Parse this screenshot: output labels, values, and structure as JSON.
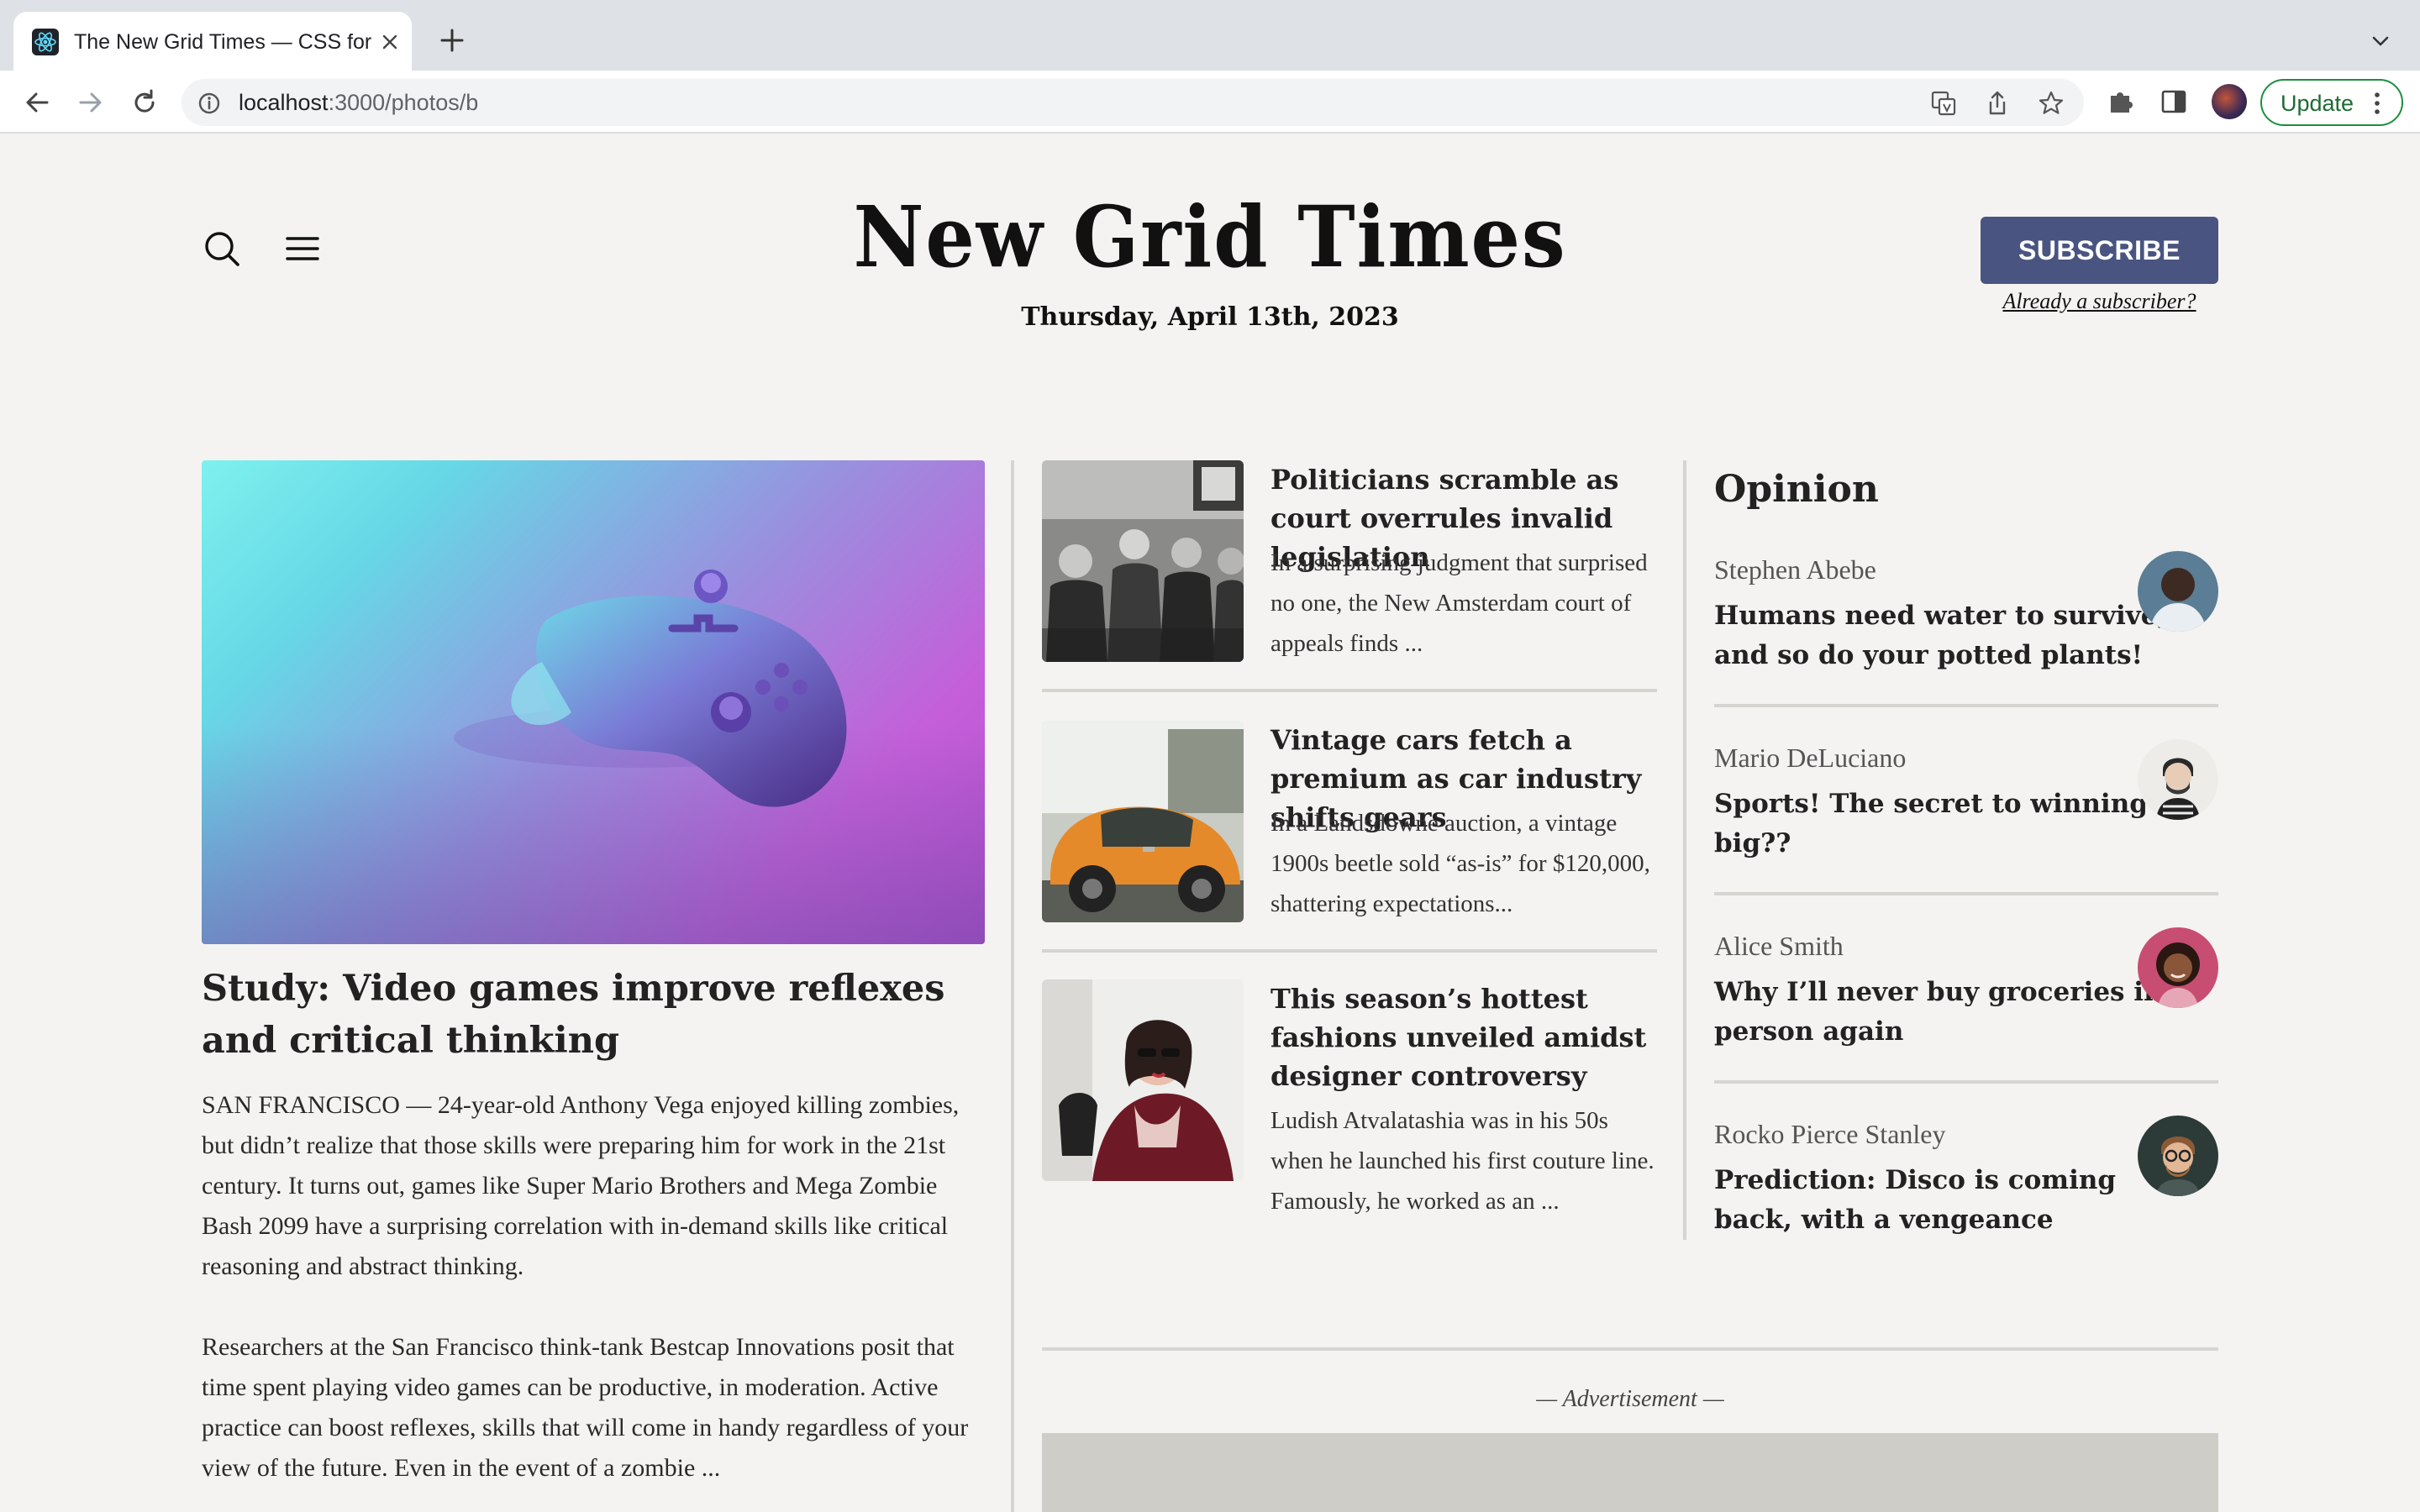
{
  "browser": {
    "tab_title": "The New Grid Times — CSS for",
    "url_host": "localhost",
    "url_rest": ":3000/photos/b",
    "update_label": "Update"
  },
  "header": {
    "masthead": "New Grid Times",
    "date": "Thursday, April 13th, 2023",
    "subscribe_label": "SUBSCRIBE",
    "already_label": "Already a subscriber?"
  },
  "main_story": {
    "headline": "Study: Video games improve reflexes and critical thinking",
    "paragraphs": [
      "SAN FRANCISCO — 24-year-old Anthony Vega enjoyed killing zombies, but didn’t realize that those skills were preparing him for work in the 21st century. It turns out, games like Super Mario Brothers and Mega Zombie Bash 2099 have a surprising correlation with in-demand skills like critical reasoning and abstract thinking.",
      "Researchers at the San Francisco think-tank Bestcap Innovations posit that time spent playing video games can be productive, in moderation. Active practice can boost reflexes, skills that will come in handy regardless of your view of the future. Even in the event of a zombie ..."
    ]
  },
  "secondary_stories": [
    {
      "title": "Politicians scramble as court overrules invalid legislation",
      "excerpt": "In a surprising judgment that surprised no one, the New Amsterdam court of appeals finds ..."
    },
    {
      "title": "Vintage cars fetch a premium as car industry shifts gears",
      "excerpt": "In a Landsdowne auction, a vintage 1900s beetle sold “as-is” for $120,000, shattering expectations..."
    },
    {
      "title": "This season’s hottest fashions unveiled amidst designer controversy",
      "excerpt": "Ludish Atvalatashia was in his 50s when he launched his first couture line. Famously, he worked as an ..."
    }
  ],
  "opinion": {
    "heading": "Opinion",
    "items": [
      {
        "author": "Stephen Abebe",
        "title": "Humans need water to survive, and so do your potted plants!",
        "avatar_color": "#5b7d95"
      },
      {
        "author": "Mario DeLuciano",
        "title": "Sports! The secret to winning big??",
        "avatar_color": "#e9e6e2"
      },
      {
        "author": "Alice Smith",
        "title": "Why I’ll never buy groceries in-person again",
        "avatar_color": "#c84d72"
      },
      {
        "author": "Rocko Pierce Stanley",
        "title": "Prediction: Disco is coming back, with a vengeance",
        "avatar_color": "#2c3b38"
      }
    ]
  },
  "advertisement": {
    "label": "— Advertisement —"
  },
  "colors": {
    "subscribe_bg": "#495580",
    "page_bg": "#f4f3f1",
    "rule": "#d6d4d0"
  }
}
